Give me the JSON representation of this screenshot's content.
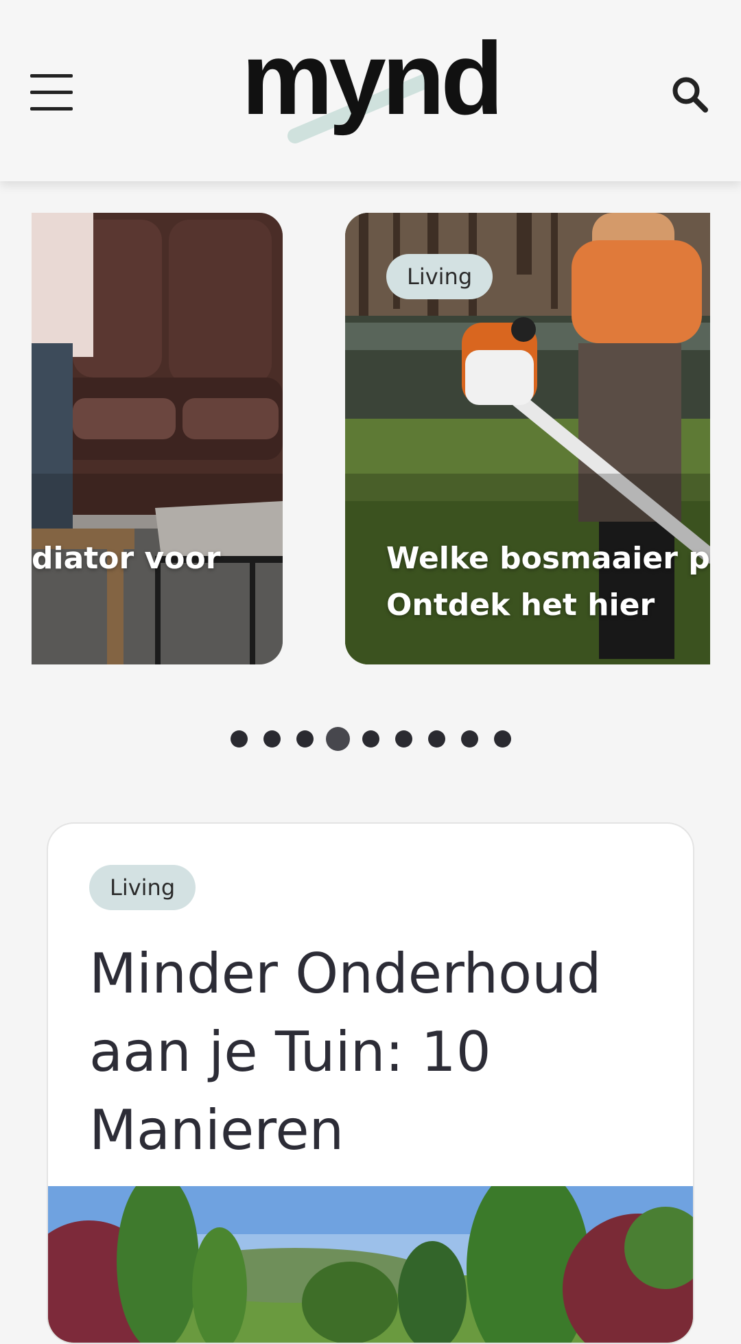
{
  "header": {
    "brand": "mynd",
    "menu_icon": "hamburger-menu-icon",
    "search_icon": "search-icon"
  },
  "carousel": {
    "slides": [
      {
        "title": "diator voor"
      },
      {
        "category": "Living",
        "title_line1": "Welke bosmaaier past",
        "title_line2": "Ontdek het hier"
      }
    ],
    "dot_count": 9,
    "active_dot": 4
  },
  "featured": {
    "category": "Living",
    "title": "Minder Onderhoud aan je Tuin: 10 Manieren"
  },
  "colors": {
    "background": "#f5f5f5",
    "pill": "#d3e1e2",
    "text": "#2c2c36"
  }
}
